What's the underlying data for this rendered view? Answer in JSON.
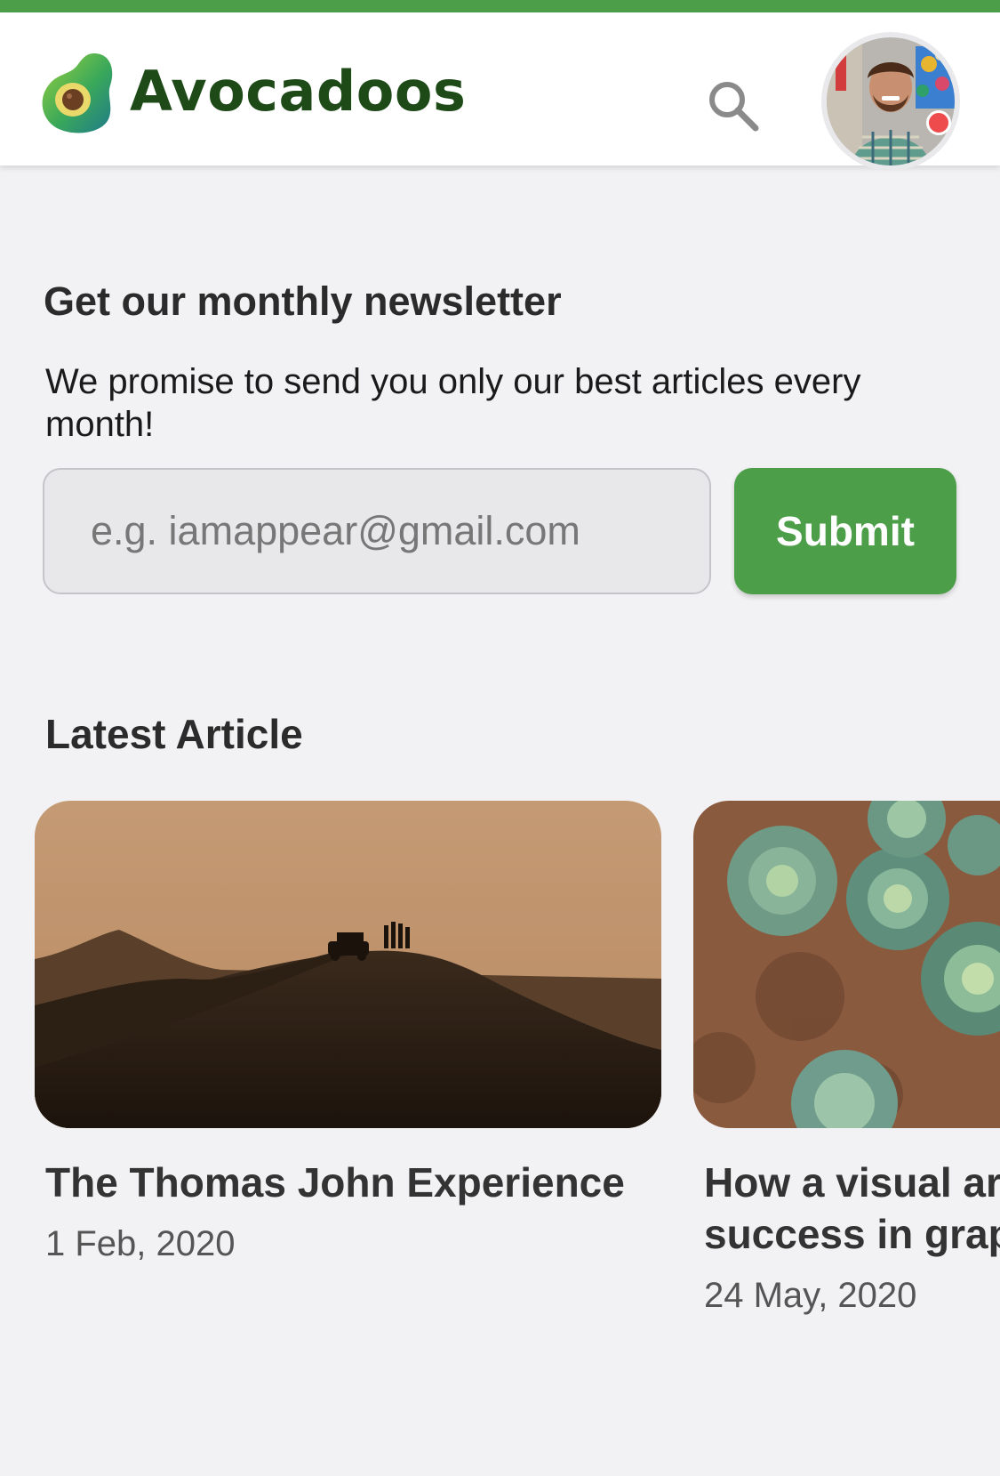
{
  "header": {
    "brand": "Avocadoos",
    "accent_color": "#4c9f48",
    "search_icon": "search-icon",
    "avatar_notification_color": "#ee4c4c"
  },
  "newsletter": {
    "title": "Get our monthly newsletter",
    "description": "We promise to send you only our best articles every month!",
    "email_placeholder": "e.g. iamappear@gmail.com",
    "email_value": "",
    "submit_label": "Submit"
  },
  "latest": {
    "section_title": "Latest Article",
    "articles": [
      {
        "title": "The Thomas John Experience",
        "date": "1 Feb, 2020"
      },
      {
        "title": "How a visual artist redefines success in graphic design",
        "date": "24 May, 2020"
      }
    ]
  }
}
